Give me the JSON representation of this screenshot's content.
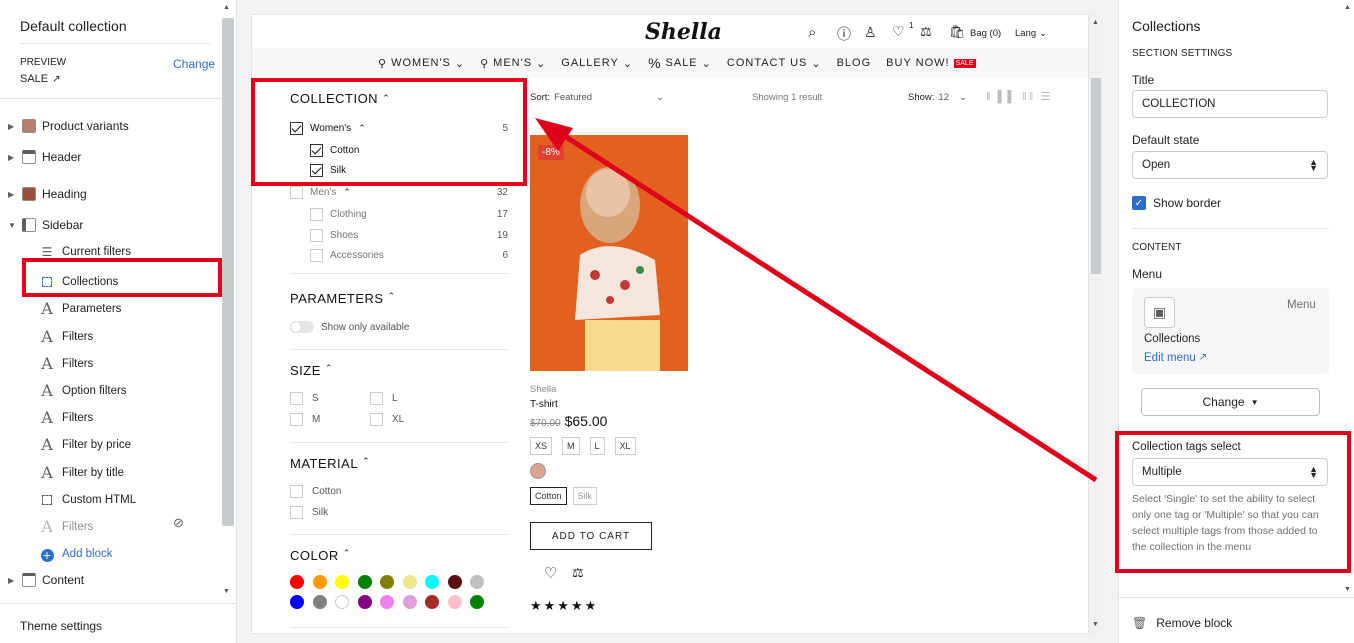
{
  "left": {
    "title": "Default collection",
    "preview_label": "PREVIEW",
    "change_label": "Change",
    "preview_value": "SALE",
    "tree": [
      {
        "label": "Product variants"
      },
      {
        "label": "Header"
      },
      {
        "label": "Heading"
      },
      {
        "label": "Sidebar"
      }
    ],
    "sidebar_blocks": [
      {
        "label": "Current filters",
        "icon": "lines-icon"
      },
      {
        "label": "Collections",
        "icon": "dashed-square-icon"
      },
      {
        "label": "Parameters",
        "icon": "text-icon"
      },
      {
        "label": "Filters",
        "icon": "text-icon"
      },
      {
        "label": "Filters",
        "icon": "text-icon"
      },
      {
        "label": "Option filters",
        "icon": "text-icon"
      },
      {
        "label": "Filters",
        "icon": "text-icon"
      },
      {
        "label": "Filter by price",
        "icon": "text-icon"
      },
      {
        "label": "Filter by title",
        "icon": "text-icon"
      },
      {
        "label": "Custom HTML",
        "icon": "dashed-square-icon"
      },
      {
        "label": "Filters",
        "icon": "text-icon"
      }
    ],
    "add_block": "Add block",
    "content": "Content",
    "theme_settings": "Theme settings"
  },
  "store": {
    "logo": "Shella",
    "wishlist_count": "1",
    "bag": "Bag (0)",
    "lang": "Lang",
    "nav": [
      "WOMEN'S",
      "MEN'S",
      "GALLERY",
      "SALE",
      "CONTACT US",
      "BLOG",
      "BUY NOW!"
    ],
    "nav_badge": "SALE",
    "sort_label": "Sort:",
    "sort_value": "Featured",
    "showing": "Showing 1 result",
    "show_label": "Show:",
    "show_value": "12",
    "filters": {
      "collection_title": "COLLECTION",
      "collection_items": [
        {
          "label": "Women's",
          "count": "5",
          "checked": true
        },
        {
          "label": "Cotton",
          "count": "",
          "checked": true
        },
        {
          "label": "Silk",
          "count": "",
          "checked": true
        },
        {
          "label": "Men's",
          "count": "32",
          "checked": false
        },
        {
          "label": "Clothing",
          "count": "17",
          "checked": false
        },
        {
          "label": "Shoes",
          "count": "19",
          "checked": false
        },
        {
          "label": "Accessories",
          "count": "6",
          "checked": false
        }
      ],
      "parameters_title": "PARAMETERS",
      "show_only_available": "Show only available",
      "size_title": "SIZE",
      "sizes": [
        "S",
        "L",
        "M",
        "XL"
      ],
      "material_title": "MATERIAL",
      "materials": [
        "Cotton",
        "Silk"
      ],
      "color_title": "COLOR",
      "colors": [
        "#ff0000",
        "#ff9900",
        "#ffff00",
        "#008000",
        "#808000",
        "#f0e68c",
        "#00ffff",
        "#5c1010",
        "#c0c0c0",
        "#0000ff",
        "#808080",
        "#ffffff",
        "#800080",
        "#ee82ee",
        "#dda0dd",
        "#a52a2a",
        "#ffc0cb",
        "#008000"
      ]
    },
    "product": {
      "badge": "-8%",
      "vendor": "Shella",
      "title": "T-shirt",
      "old_price": "$70.00",
      "price": "$65.00",
      "sizes": [
        "XS",
        "M",
        "L",
        "XL"
      ],
      "materials": [
        "Cotton",
        "Silk"
      ],
      "add_to_cart": "ADD TO CART",
      "stars": "★★★★★"
    }
  },
  "right": {
    "title": "Collections",
    "section_settings": "SECTION SETTINGS",
    "title_label": "Title",
    "title_value": "COLLECTION",
    "default_state_label": "Default state",
    "default_state_value": "Open",
    "show_border": "Show border",
    "content_label": "CONTENT",
    "menu_label": "Menu",
    "menu_card_tag": "Menu",
    "menu_name": "Collections",
    "edit_menu": "Edit menu",
    "change_button": "Change",
    "tags_select_label": "Collection tags select",
    "tags_select_value": "Multiple",
    "tags_help": "Select 'Single' to set the ability to select only one tag or 'Multiple' so that you can select multiple tags from those added to the collection in the menu",
    "remove_block": "Remove block"
  },
  "colors": {
    "accent": "#2c6ecb",
    "highlight": "#e0001b"
  }
}
